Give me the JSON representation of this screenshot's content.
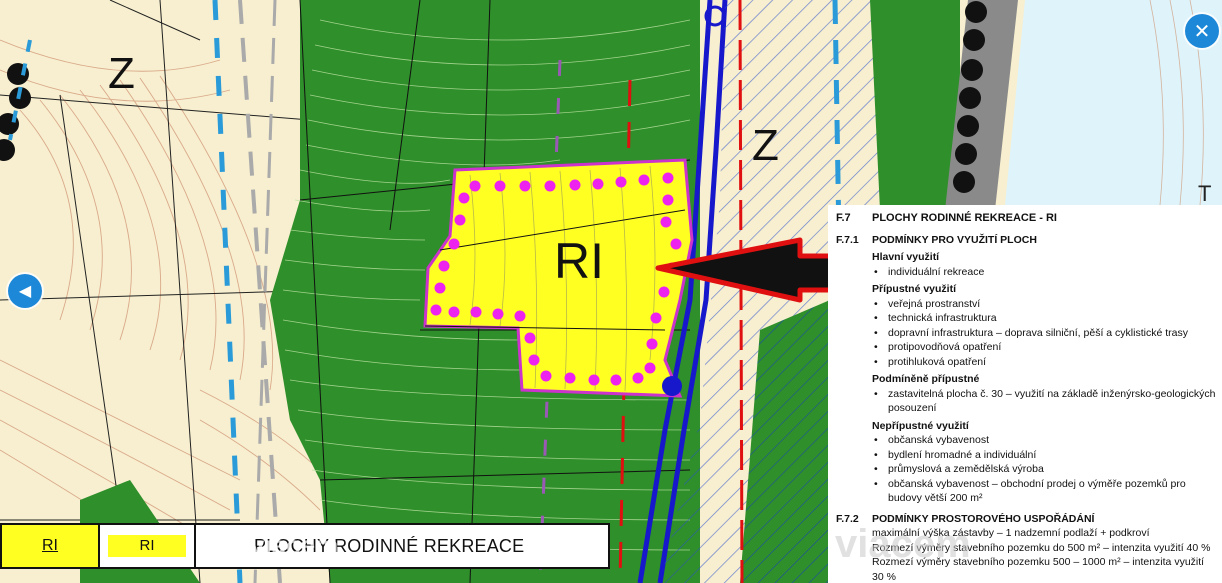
{
  "map": {
    "zone_labels": [
      "Z",
      "Z"
    ],
    "plot_label": "RI",
    "edge_label": "T V",
    "colors": {
      "agricultural_land": "#f7efcf",
      "forest": "#2f8f2a",
      "forest_dark": "#1f6e1c",
      "recreation_zone": "#ffff22",
      "recreation_border": "#cc33cc",
      "boundary_dots": "#ee22ee",
      "river": "#1717cc",
      "road": "#8a8a8a",
      "water": "#dff3fb",
      "arrow": "#e01010"
    }
  },
  "legend": {
    "code": "RI",
    "swatch_code": "RI",
    "name": "PLOCHY RODINNÉ REKREACE"
  },
  "watermark": "viacem",
  "controls": {
    "prev_icon": "chevron-left-icon",
    "next_icon": "chevron-right-icon",
    "close_icon": "close-icon",
    "prev_symbol": "◀",
    "next_symbol": "▶",
    "close_symbol": "✕"
  },
  "document": {
    "section_num": "F.7",
    "section_title": "PLOCHY RODINNÉ REKREACE - RI",
    "sub1_num": "F.7.1",
    "sub1_title": "PODMÍNKY PRO VYUŽITÍ PLOCH",
    "main_use_title": "Hlavní využití",
    "main_use": [
      "individuální rekreace"
    ],
    "permitted_title": "Přípustné využití",
    "permitted": [
      "veřejná prostranství",
      "technická infrastruktura",
      "dopravní infrastruktura – doprava silniční, pěší a cyklistické trasy",
      "protipovodňová opatření",
      "protihluková opatření"
    ],
    "conditional_title": "Podmíněně přípustné",
    "conditional": [
      "zastavitelná plocha č. 30 – využití na základě inženýrsko-geologických posouzení"
    ],
    "forbidden_title": "Nepřípustné využití",
    "forbidden": [
      "občanská vybavenost",
      "bydlení hromadné a individuální",
      "průmyslová a zemědělská výroba",
      "občanská vybavenost – obchodní prodej o výměře pozemků pro budovy větší 200 m²"
    ],
    "sub2_num": "F.7.2",
    "sub2_title": "PODMÍNKY PROSTOROVÉHO USPOŘÁDÁNÍ",
    "spatial": [
      "maximální výška zástavby – 1 nadzemní podlaží + podkroví",
      "Rozmezí výměry stavebního pozemku do 500 m² – intenzita využití 40 %",
      "Rozmezí výměry stavebního pozemku 500 – 1000 m² – intenzita využití 30 %"
    ]
  }
}
